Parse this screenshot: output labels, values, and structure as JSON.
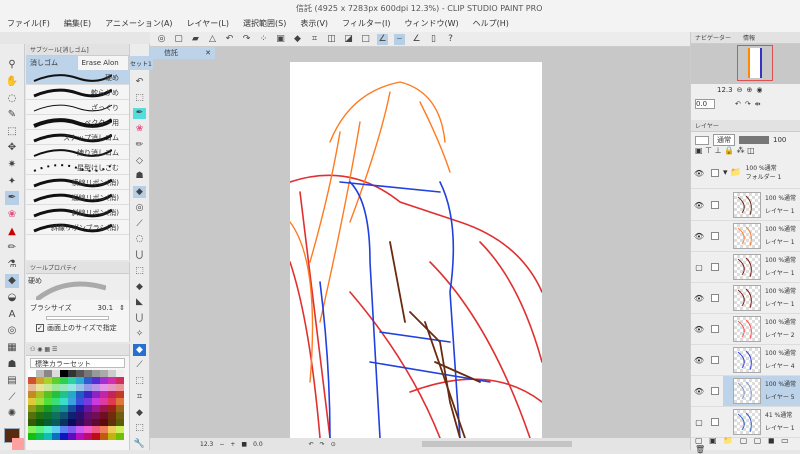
{
  "title": "信託 (4925 x 7283px 600dpi 12.3%)  - CLIP STUDIO PAINT PRO",
  "menu": [
    "ファイル(F)",
    "編集(E)",
    "アニメーション(A)",
    "レイヤー(L)",
    "選択範囲(S)",
    "表示(V)",
    "フィルター(I)",
    "ウィンドウ(W)",
    "ヘルプ(H)"
  ],
  "subtool": {
    "header": "サブツール[消しゴム]",
    "tabs": [
      "消しゴム",
      "Erase Alon",
      "セット1"
    ],
    "brushes": [
      "硬め",
      "軟らかめ",
      "ざっくり",
      "ベクター用",
      "スナップ消しゴム",
      "練り消しゴム",
      "星型けしごむ",
      "横線リボン(消)",
      "縦線リボン(消)",
      "斜線リボン(消)",
      "斜線リボンブラシ(消)"
    ]
  },
  "toolprop": {
    "header": "ツールプロパティ",
    "preset": "硬め",
    "brush_size_label": "ブラシサイズ",
    "brush_size": "30.1",
    "fit_label": "画面上のサイズで指定"
  },
  "colorset": {
    "selected": "標準カラーセット",
    "main_color": "#5a2a10",
    "sub_color": "#ffa0a0"
  },
  "canvas": {
    "tab": "信託",
    "zoom": "12.3",
    "angle": "0.0"
  },
  "navigator": {
    "tabs": [
      "ナビゲーター",
      "情報"
    ],
    "zoom": "12.3",
    "angle": "0.0"
  },
  "layers": {
    "tabs": [
      "レイヤー"
    ],
    "blend": "通常",
    "opacity": "100",
    "folder": {
      "opacity": "100 %通常",
      "name": "フォルダー 1"
    },
    "items": [
      {
        "opacity": "100 %通常",
        "name": "レイヤー 1",
        "visible": true
      },
      {
        "opacity": "100 %通常",
        "name": "レイヤー 1",
        "visible": true
      },
      {
        "opacity": "100 %通常",
        "name": "レイヤー 1",
        "visible": false
      },
      {
        "opacity": "100 %通常",
        "name": "レイヤー 1",
        "visible": true
      },
      {
        "opacity": "100 %通常",
        "name": "レイヤー 2",
        "visible": true
      },
      {
        "opacity": "100 %通常",
        "name": "レイヤー 4",
        "visible": true
      },
      {
        "opacity": "100 %通常",
        "name": "レイヤー 5",
        "visible": true,
        "selected": true
      },
      {
        "opacity": "41 %通常",
        "name": "レイヤー 1",
        "visible": false
      }
    ]
  }
}
